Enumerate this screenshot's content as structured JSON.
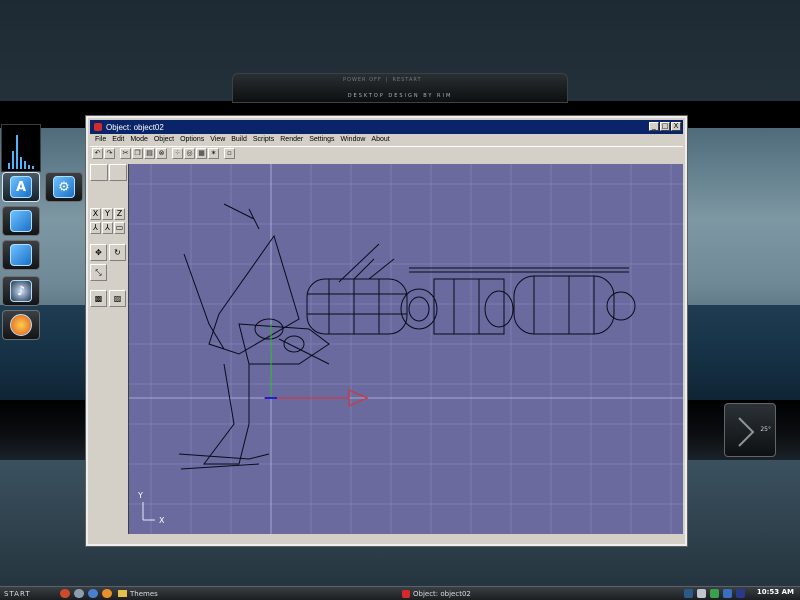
{
  "desktop": {
    "top_panel": {
      "buttons": [
        "POWER OFF",
        "RESTART"
      ],
      "title": "DESKTOP DESIGN BY RIM"
    },
    "weather_widget": {
      "temperature": "25°"
    }
  },
  "window": {
    "title": "Object: object02",
    "controls": [
      "_",
      "□",
      "X"
    ],
    "menu": [
      "File",
      "Edit",
      "Mode",
      "Object",
      "Options",
      "View",
      "Build",
      "Scripts",
      "Render",
      "Settings",
      "Window",
      "About"
    ],
    "side_tools": {
      "xyz": [
        "X",
        "Y",
        "Z"
      ]
    },
    "viewport": {
      "axis_labels": {
        "y": "Y",
        "x": "X"
      }
    }
  },
  "taskbar": {
    "start_label": "START",
    "items": [
      {
        "label": "Themes",
        "icon": "folder-icon"
      },
      {
        "label": "Object: object02",
        "icon": "app-icon"
      }
    ],
    "clock": "10:53 AM"
  },
  "colors": {
    "viewport_bg": "#6a6a9e",
    "titlebar": "#0a246a",
    "window_chrome": "#d4d0c8",
    "axis_x": "#e03030",
    "axis_y": "#30c030"
  }
}
